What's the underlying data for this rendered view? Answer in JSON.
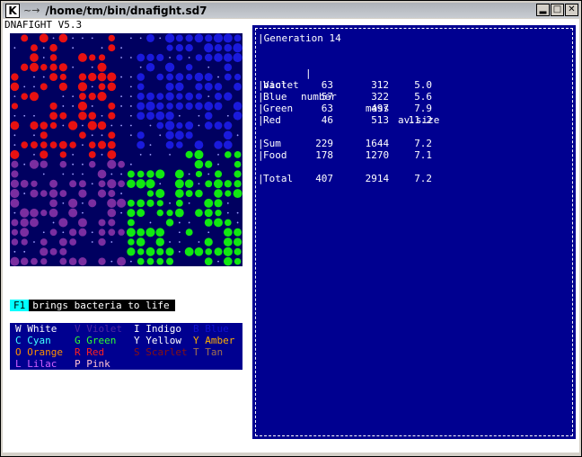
{
  "window": {
    "title": "/home/tm/bin/dnafight.sd7",
    "app_icon": "K",
    "sys_icon": "~→"
  },
  "app": {
    "title": "DNAFIGHT V5.3",
    "hint_key": "F1",
    "hint_text": "brings bacteria to life"
  },
  "colors": {
    "violet": "#7a2ea0",
    "blue": "#1a1adc",
    "green": "#11e811",
    "red": "#e81111",
    "food": "#a0a0ff",
    "bg": "#000060"
  },
  "palette": [
    {
      "text": "W White",
      "color": "#ffffff"
    },
    {
      "text": "V Violet",
      "color": "#5028a0"
    },
    {
      "text": "I Indigo",
      "color": "#ffffff"
    },
    {
      "text": "B Blue",
      "color": "#1010d0"
    },
    {
      "text": "C Cyan",
      "color": "#40ffff"
    },
    {
      "text": "G Green",
      "color": "#30ff30"
    },
    {
      "text": "Y Yellow",
      "color": "#ffffff"
    },
    {
      "text": "Y Amber",
      "color": "#ffb000"
    },
    {
      "text": "O Orange",
      "color": "#ff9000"
    },
    {
      "text": "R Red",
      "color": "#ff2020"
    },
    {
      "text": "S Scarlet",
      "color": "#8a1010"
    },
    {
      "text": "T Tan",
      "color": "#a07050"
    },
    {
      "text": "L Lilac",
      "color": "#d060ff"
    },
    {
      "text": "P Pink",
      "color": "#ffc0d0"
    }
  ],
  "stats": {
    "generation": "Generation 14",
    "headers": [
      "bact",
      "number",
      "mass",
      "av.size"
    ],
    "rows": [
      [
        "Violet",
        "63",
        "312",
        "5.0"
      ],
      [
        "Blue",
        "57",
        "322",
        "5.6"
      ],
      [
        "Green",
        "63",
        "497",
        "7.9"
      ],
      [
        "Red",
        "46",
        "513",
        "11.2"
      ]
    ],
    "sum": [
      "Sum",
      "229",
      "1644",
      "7.2"
    ],
    "food": [
      "Food",
      "178",
      "1270",
      "7.1"
    ],
    "total": [
      "Total",
      "407",
      "2914",
      "7.2"
    ]
  }
}
